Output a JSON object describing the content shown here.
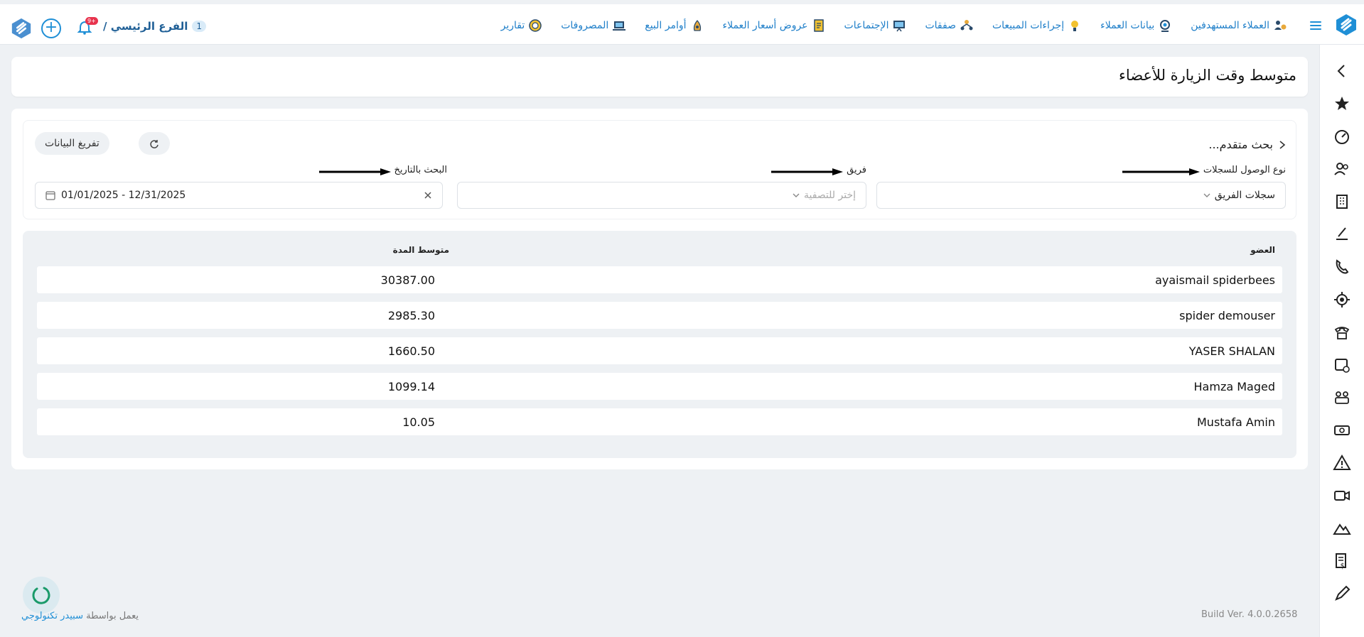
{
  "nav": {
    "items": [
      {
        "label": "العملاء المستهدفين",
        "icon": "target-customers-icon"
      },
      {
        "label": "بيانات العملاء",
        "icon": "customer-data-icon"
      },
      {
        "label": "إجراءات المبيعات",
        "icon": "sales-actions-icon"
      },
      {
        "label": "صفقات",
        "icon": "deals-icon"
      },
      {
        "label": "الإجتماعات",
        "icon": "meetings-icon"
      },
      {
        "label": "عروض أسعار العملاء",
        "icon": "quotes-icon"
      },
      {
        "label": "أوامر البيع",
        "icon": "sales-orders-icon"
      },
      {
        "label": "المصروفات",
        "icon": "expenses-icon"
      },
      {
        "label": "تقارير",
        "icon": "reports-icon"
      }
    ],
    "branch": "الفرع الرئيسي /",
    "branch_badge": "1",
    "notification_count": "+9"
  },
  "page": {
    "title": "متوسط وقت الزيارة للأعضاء"
  },
  "filters": {
    "advanced_search": "بحث متقدم...",
    "reset_label": "تفريغ البيانات",
    "access_type_label": "نوع الوصول للسجلات",
    "access_type_value": "سجلات الفريق",
    "team_label": "فريق",
    "team_placeholder": "إختر للتصفية",
    "date_label": "البحث بالتاريخ",
    "date_value": "01/01/2025 - 12/31/2025"
  },
  "table": {
    "columns": {
      "member": "العضو",
      "avg_duration": "متوسط المدة"
    },
    "rows": [
      {
        "member": "ayaismail spiderbees",
        "avg_duration": "30387.00"
      },
      {
        "member": "spider demouser",
        "avg_duration": "2985.30"
      },
      {
        "member": "YASER SHALAN",
        "avg_duration": "1660.50"
      },
      {
        "member": "Hamza Maged",
        "avg_duration": "1099.14"
      },
      {
        "member": "Mustafa Amin",
        "avg_duration": "10.05"
      }
    ]
  },
  "footer": {
    "powered_prefix": "يعمل بواسطة",
    "powered_brand": "سبيدر تكنولوجي",
    "build": "Build Ver. 4.0.0.2658"
  },
  "colors": {
    "accent": "#1f8fd6",
    "background": "#eef1f4"
  }
}
